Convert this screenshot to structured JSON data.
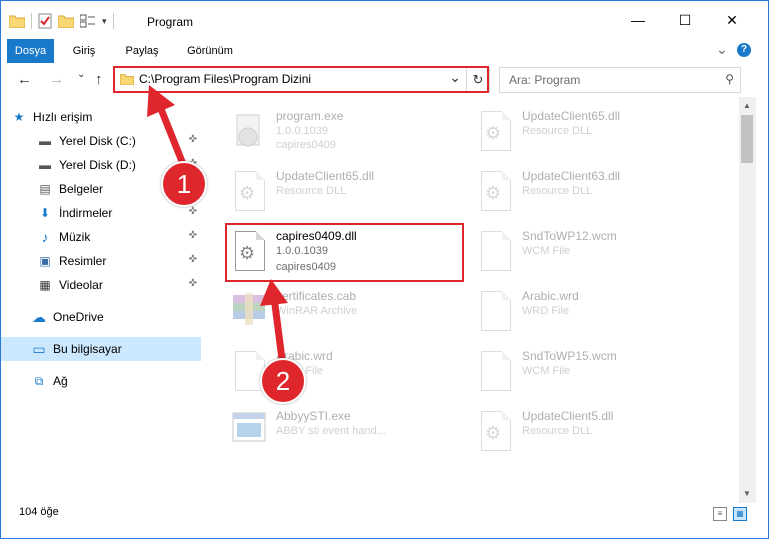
{
  "window": {
    "title": "Program",
    "controls": {
      "minimize": "—",
      "maximize": "☐",
      "close": "✕"
    }
  },
  "ribbon": {
    "tabs": [
      "Dosya",
      "Giriş",
      "Paylaş",
      "Görünüm"
    ],
    "active_tab": "Dosya",
    "expand_glyph": "⌄",
    "help_glyph": "?"
  },
  "navigation": {
    "back": "←",
    "forward": "→",
    "dropdown": "⌄",
    "up": "↑",
    "address": "C:\\Program Files\\Program Dizini",
    "address_dropdown": "⌄",
    "refresh": "↻",
    "search_placeholder": "Ara: Program",
    "search_glyph": "⚲"
  },
  "sidebar": {
    "items": [
      {
        "label": "Hızlı erişim",
        "icon": "star-icon",
        "glyph": "★",
        "pinned": false
      },
      {
        "label": "Yerel Disk (C:)",
        "icon": "drive-icon",
        "glyph": "▬",
        "pinned": true
      },
      {
        "label": "Yerel Disk (D:)",
        "icon": "drive-icon",
        "glyph": "▬",
        "pinned": true
      },
      {
        "label": "Belgeler",
        "icon": "documents-icon",
        "glyph": "▤",
        "pinned": true
      },
      {
        "label": "İndirmeler",
        "icon": "download-icon",
        "glyph": "⬇",
        "pinned": true
      },
      {
        "label": "Müzik",
        "icon": "music-icon",
        "glyph": "♪",
        "pinned": true
      },
      {
        "label": "Resimler",
        "icon": "pictures-icon",
        "glyph": "▣",
        "pinned": true
      },
      {
        "label": "Videolar",
        "icon": "video-icon",
        "glyph": "▦",
        "pinned": true
      },
      {
        "label": "OneDrive",
        "icon": "cloud-icon",
        "glyph": "☁",
        "pinned": false
      },
      {
        "label": "Bu bilgisayar",
        "icon": "computer-icon",
        "glyph": "▭",
        "pinned": false,
        "selected": true
      },
      {
        "label": "Ağ",
        "icon": "network-icon",
        "glyph": "⧉",
        "pinned": false
      }
    ],
    "pin_glyph": "📌"
  },
  "files": [
    {
      "name": "program.exe",
      "line2": "1.0.0.1039",
      "line3": "capires0409",
      "icon": "exe-icon",
      "faded": true
    },
    {
      "name": "UpdateClient65.dll",
      "line2": "Resource DLL",
      "line3": "",
      "icon": "dll-icon",
      "faded": true
    },
    {
      "name": "UpdateClient65.dll",
      "line2": "Resource DLL",
      "line3": "",
      "icon": "dll-icon",
      "faded": true
    },
    {
      "name": "UpdateClient63.dll",
      "line2": "Resource DLL",
      "line3": "",
      "icon": "dll-icon",
      "faded": true
    },
    {
      "name": "capires0409.dll",
      "line2": "1.0.0.1039",
      "line3": "capires0409",
      "icon": "dll-icon",
      "faded": false
    },
    {
      "name": "SndToWP12.wcm",
      "line2": "WCM File",
      "line3": "",
      "icon": "document-icon",
      "faded": true
    },
    {
      "name": "certificates.cab",
      "line2": "WinRAR Archive",
      "line3": "",
      "icon": "archive-icon",
      "faded": true
    },
    {
      "name": "Arabic.wrd",
      "line2": "WRD File",
      "line3": "",
      "icon": "document-icon",
      "faded": true
    },
    {
      "name": "Arabic.wrd",
      "line2": "WRD File",
      "line3": "",
      "icon": "document-icon",
      "faded": true
    },
    {
      "name": "SndToWP15.wcm",
      "line2": "WCM File",
      "line3": "",
      "icon": "document-icon",
      "faded": true
    },
    {
      "name": "AbbyySTI.exe",
      "line2": "ABBY sti event hand...",
      "line3": "",
      "icon": "exe-window-icon",
      "faded": true
    },
    {
      "name": "UpdateClient5.dll",
      "line2": "Resource DLL",
      "line3": "",
      "icon": "dll-icon",
      "faded": true
    }
  ],
  "status": {
    "item_count": "104 öğe"
  },
  "callouts": [
    "1",
    "2"
  ],
  "colors": {
    "accent": "#1979ca",
    "highlight": "#e0262d",
    "selected": "#cce8ff"
  }
}
